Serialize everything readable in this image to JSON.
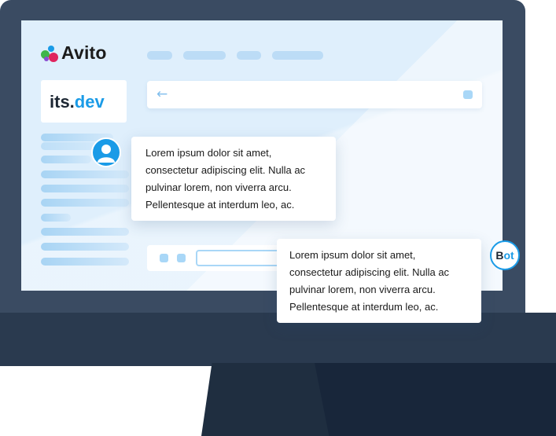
{
  "logo": {
    "text": "Avito"
  },
  "brand": {
    "part1": "its.",
    "part2": "dev"
  },
  "nav": {
    "back_icon": "arrow-left-icon"
  },
  "chat": {
    "user_message": [
      "Lorem ipsum dolor sit amet,",
      "consectetur adipiscing elit. Nulla ac",
      "pulvinar lorem, non viverra arcu.",
      "Pellentesque at interdum leo, ac."
    ],
    "bot_message": [
      "Lorem ipsum dolor sit amet,",
      "consectetur adipiscing elit. Nulla ac",
      "pulvinar lorem, non viverra arcu.",
      "Pellentesque at interdum leo, ac."
    ]
  },
  "bot": {
    "label_part1": "B",
    "label_part2": "ot"
  },
  "colors": {
    "accent_blue": "#1a9be7",
    "monitor_frame": "#3a4b62",
    "screen_bg": "#dfeffc",
    "logo_green": "#3fb649",
    "logo_blue": "#1a9be7",
    "logo_red": "#e0245e",
    "logo_purple": "#8a4fd1"
  }
}
